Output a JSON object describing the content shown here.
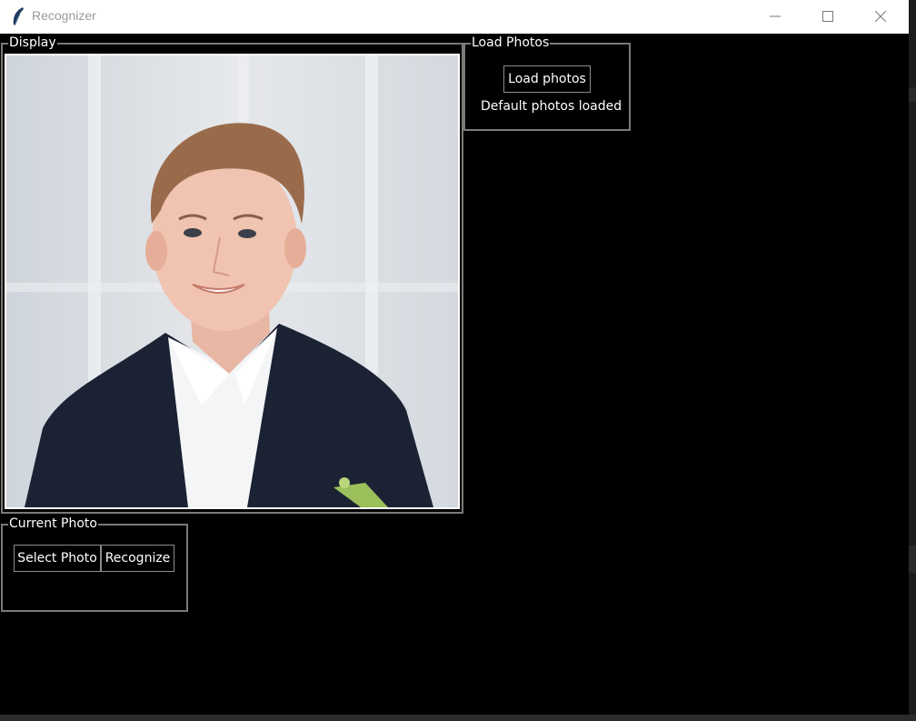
{
  "window": {
    "title": "Recognizer",
    "icon": "feather-icon"
  },
  "display": {
    "label": "Display",
    "image": "portrait-photo"
  },
  "load_photos": {
    "label": "Load Photos",
    "button_label": "Load photos",
    "status": "Default photos loaded"
  },
  "current_photo": {
    "label": "Current Photo",
    "select_label": "Select Photo",
    "recognize_label": "Recognize"
  },
  "colors": {
    "background": "#000000",
    "frame_border": "#7a7a7a",
    "titlebar": "#ffffff"
  }
}
